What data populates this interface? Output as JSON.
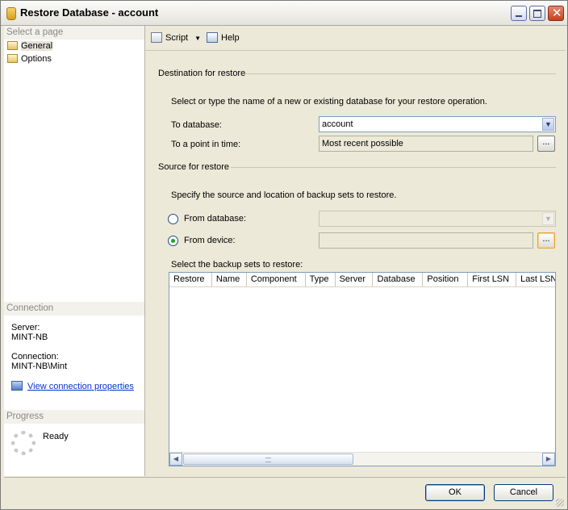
{
  "window": {
    "title": "Restore Database - account"
  },
  "left": {
    "select_page_header": "Select a page",
    "pages": [
      {
        "label": "General",
        "selected": true
      },
      {
        "label": "Options",
        "selected": false
      }
    ],
    "connection_header": "Connection",
    "server_label": "Server:",
    "server_value": "MINT-NB",
    "connection_label": "Connection:",
    "connection_value": "MINT-NB\\Mint",
    "view_properties_link": "View connection properties",
    "progress_header": "Progress",
    "progress_status": "Ready"
  },
  "toolbar": {
    "script_label": "Script",
    "help_label": "Help"
  },
  "destination": {
    "header": "Destination for restore",
    "description": "Select or type the name of a new or existing database for your restore operation.",
    "to_database_label": "To database:",
    "to_database_value": "account",
    "point_in_time_label": "To a point in time:",
    "point_in_time_value": "Most recent possible",
    "browse_label": "..."
  },
  "source": {
    "header": "Source for restore",
    "description": "Specify the source and location of backup sets to restore.",
    "from_database_label": "From database:",
    "from_database_value": "",
    "from_device_label": "From device:",
    "from_device_value": "",
    "browse_label": "...",
    "selected_option": "From device"
  },
  "backup_sets": {
    "label": "Select the backup sets to restore:",
    "columns": [
      "Restore",
      "Name",
      "Component",
      "Type",
      "Server",
      "Database",
      "Position",
      "First LSN",
      "Last LSN"
    ],
    "rows": []
  },
  "footer": {
    "ok_label": "OK",
    "cancel_label": "Cancel"
  }
}
